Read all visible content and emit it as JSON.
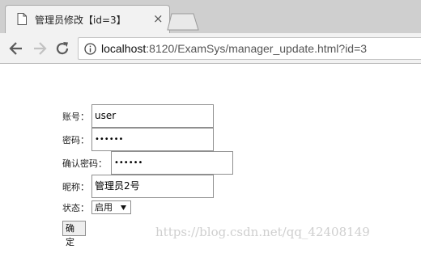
{
  "browser": {
    "tab_title": "管理员修改【id=3】",
    "tab_close": "×",
    "url_host": "localhost",
    "url_rest": ":8120/ExamSys/manager_update.html?id=3"
  },
  "form": {
    "account_label": "账号：",
    "account_value": "user",
    "password_label": "密码：",
    "password_value": "••••••",
    "confirm_label": "确认密码：",
    "confirm_value": "••••••",
    "nickname_label": "昵称：",
    "nickname_value": "管理员2号",
    "status_label": "状态：",
    "status_value": "启用",
    "submit_label": "确定"
  },
  "watermark": "https://blog.csdn.net/qq_42408149"
}
